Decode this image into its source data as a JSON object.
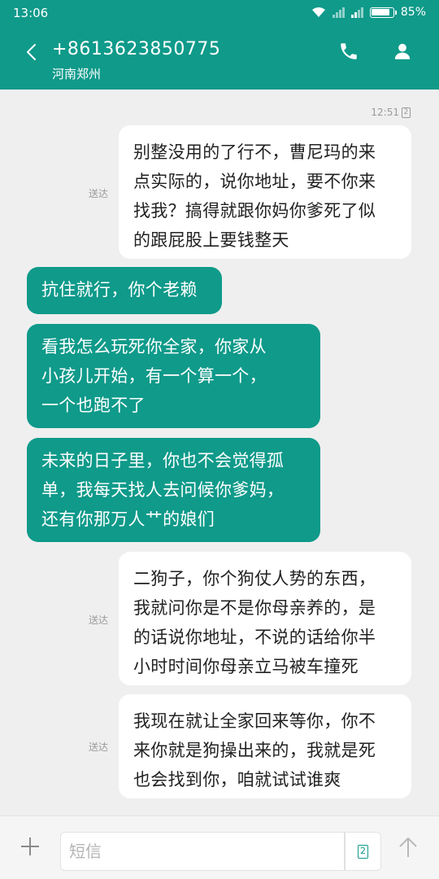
{
  "status_bar": {
    "time": "13:06",
    "battery": "85%"
  },
  "header": {
    "phone_number": "+8613623850775",
    "location": "河南郑州"
  },
  "thread": {
    "timestamp": "12:51",
    "timestamp_sim": "2",
    "messages": [
      {
        "direction": "outgoing",
        "lines": [
          "别整没用的了行不，曹尼玛的来",
          "点实际的，说你地址，要不你来",
          "找我？搞得就跟你妈你爹死了似",
          "的跟屁股上要钱整天"
        ],
        "status": "送达"
      },
      {
        "direction": "incoming",
        "lines": [
          "抗住就行，你个老赖"
        ]
      },
      {
        "direction": "incoming",
        "lines": [
          "看我怎么玩死你全家，你家从",
          "小孩儿开始，有一个算一个，",
          "一个也跑不了"
        ]
      },
      {
        "direction": "incoming",
        "lines": [
          "未来的日子里，你也不会觉得孤",
          "单，我每天找人去问候你爹妈，",
          "还有你那万人艹的娘们"
        ]
      },
      {
        "direction": "outgoing",
        "lines": [
          "二狗子，你个狗仗人势的东西，",
          "我就问你是不是你母亲养的，是",
          "的话说你地址，不说的话给你半",
          "小时时间你母亲立马被车撞死"
        ],
        "status": "送达"
      },
      {
        "direction": "outgoing",
        "lines": [
          "我现在就让全家回来等你，你不",
          "来你就是狗操出来的，我就是死",
          "也会找到你，咱就试试谁爽"
        ],
        "status": "送达"
      }
    ]
  },
  "input_bar": {
    "placeholder": "短信",
    "sim_label": "2"
  },
  "colors": {
    "accent": "#0f9a8a",
    "background": "#efefef",
    "bubble_outgoing": "#ffffff",
    "meta_text": "#9a9a9a"
  },
  "icons": {
    "back": "chevron-left-icon",
    "call": "phone-icon",
    "contact": "person-icon",
    "attach": "plus-icon",
    "send": "arrow-up-icon"
  }
}
